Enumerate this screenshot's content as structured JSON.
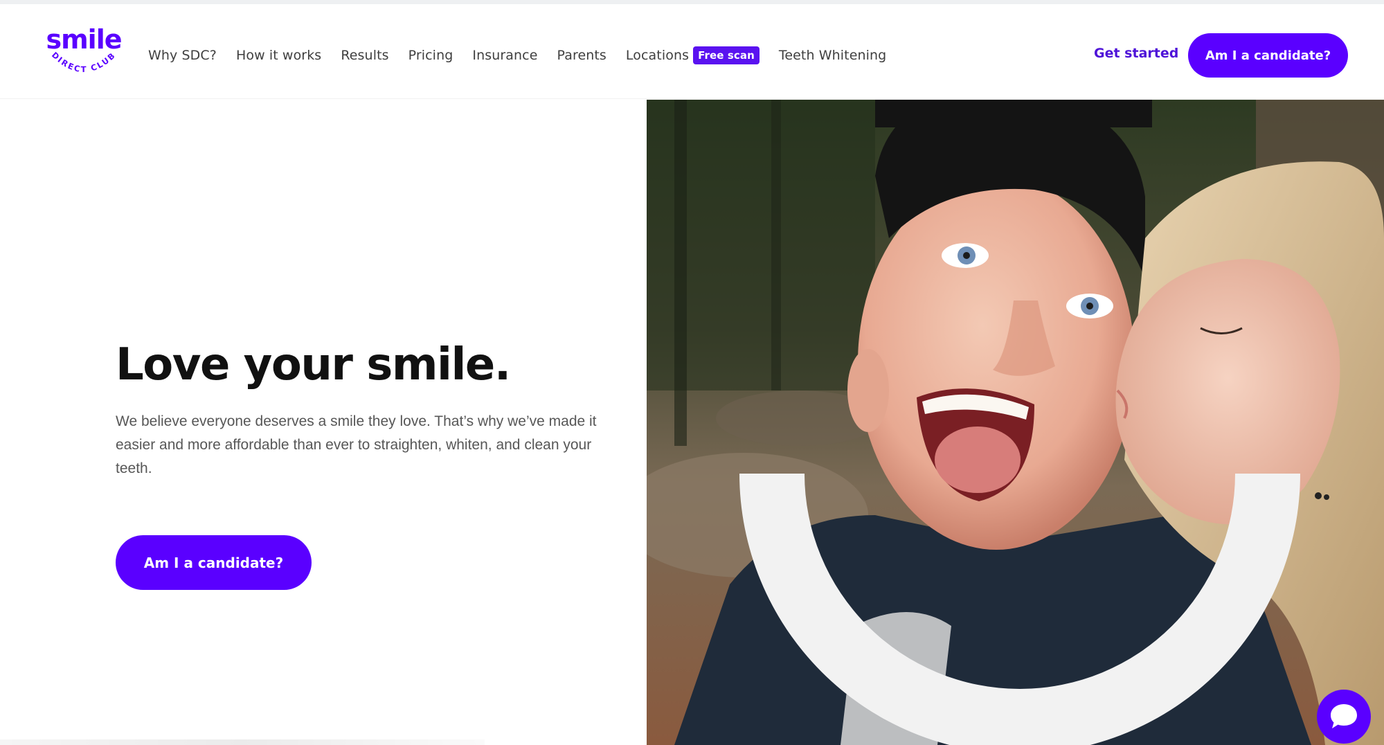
{
  "brand": {
    "logo_word": "smile",
    "logo_sub": "DIRECT CLUB",
    "accent_color": "#5a00ff"
  },
  "nav": {
    "items": [
      {
        "label": "Why SDC?"
      },
      {
        "label": "How it works"
      },
      {
        "label": "Results"
      },
      {
        "label": "Pricing"
      },
      {
        "label": "Insurance"
      },
      {
        "label": "Parents"
      },
      {
        "label": "Locations",
        "badge": "Free scan"
      },
      {
        "label": "Teeth Whitening"
      }
    ],
    "get_started": "Get started",
    "cta": "Am I a candidate?"
  },
  "hero": {
    "title": "Love your smile.",
    "body": "We believe everyone deserves a smile they love. That’s why we’ve made it easier and more affordable than ever to straighten, whiten, and clean your teeth.",
    "cta": "Am I a candidate?",
    "image_icon": "couple-photo"
  },
  "chat": {
    "icon": "chat-bubble-icon"
  }
}
